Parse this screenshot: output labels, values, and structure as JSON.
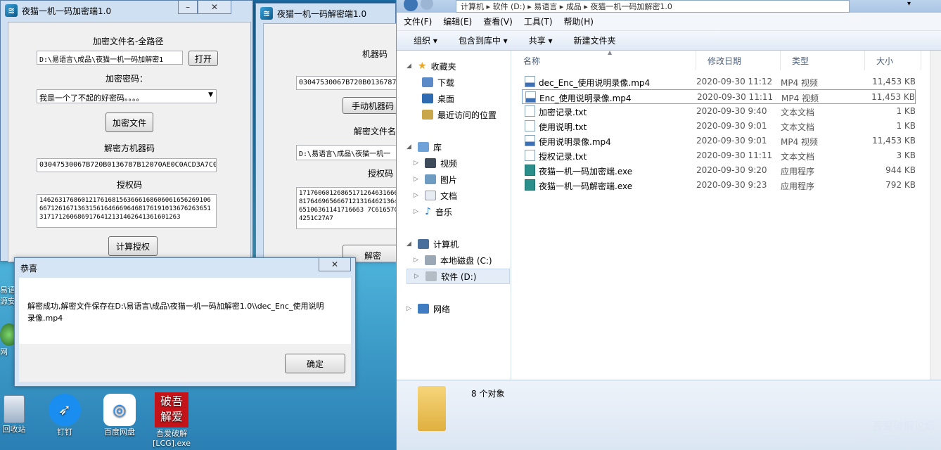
{
  "enc_window": {
    "title": "夜猫一机一码加密端1.0",
    "lbl_path": "加密文件名-全路径",
    "path_value": "D:\\易语言\\成品\\夜猫一机一码加解密1",
    "btn_open": "打开",
    "lbl_pwd": "加密密码：",
    "pwd_value": "我是一个了不起的好密码。。。。",
    "btn_encrypt": "加密文件",
    "lbl_decmachine": "解密方机器码",
    "decmachine_value": "03047530067B720B0136787B12070AE0C0ACD3A7C0",
    "lbl_auth": "授权码",
    "auth_value": "1462631768601217616815636661686060616562691066671261671363156164666964681761910136762636513171712606869176412131462641361601263",
    "btn_calc": "计算授权"
  },
  "dec_window": {
    "title": "夜猫一机一码解密端1.0",
    "lbl_machine": "机器码",
    "machine_value": "03047530067B720B01367871",
    "btn_manual": "手动机器码",
    "lbl_file": "解密文件名",
    "file_value": "D:\\易语言\\成品\\夜猫一机一",
    "lbl_auth": "授权码",
    "auth_value": "1717606012686517126463166646817646965666712131646213641365106361141716663 7C61657C694251C27A7",
    "btn_decrypt": "解密"
  },
  "dialog": {
    "title": "恭喜",
    "message": "解密成功,解密文件保存在D:\\易语言\\成品\\夜猫一机一码加解密1.0\\\\dec_Enc_使用说明录像.mp4",
    "ok": "确定"
  },
  "explorer": {
    "breadcrumb": [
      "计算机",
      "软件 (D:)",
      "易语言",
      "成品",
      "夜猫一机一码加解密1.0"
    ],
    "menu": [
      "文件(F)",
      "编辑(E)",
      "查看(V)",
      "工具(T)",
      "帮助(H)"
    ],
    "toolbar": [
      "组织 ▾",
      "包含到库中 ▾",
      "共享 ▾",
      "新建文件夹"
    ],
    "nav": {
      "favorites": "收藏夹",
      "downloads": "下载",
      "desktop": "桌面",
      "recent": "最近访问的位置",
      "libraries": "库",
      "videos": "视频",
      "pictures": "图片",
      "documents": "文档",
      "music": "音乐",
      "computer": "计算机",
      "drive_c": "本地磁盘 (C:)",
      "drive_d": "软件 (D:)",
      "network": "网络"
    },
    "columns": {
      "name": "名称",
      "date": "修改日期",
      "type": "类型",
      "size": "大小"
    },
    "files": [
      {
        "name": "dec_Enc_使用说明录像.mp4",
        "date": "2020-09-30 11:12",
        "type": "MP4 视频",
        "size": "11,453 KB",
        "icon": "video-file-icon"
      },
      {
        "name": "Enc_使用说明录像.mp4",
        "date": "2020-09-30 11:11",
        "type": "MP4 视频",
        "size": "11,453 KB",
        "icon": "video-file-icon"
      },
      {
        "name": "加密记录.txt",
        "date": "2020-09-30 9:40",
        "type": "文本文档",
        "size": "1 KB",
        "icon": "text-file-icon"
      },
      {
        "name": "使用说明.txt",
        "date": "2020-09-30 9:01",
        "type": "文本文档",
        "size": "1 KB",
        "icon": "text-file-icon"
      },
      {
        "name": "使用说明录像.mp4",
        "date": "2020-09-30 9:01",
        "type": "MP4 视频",
        "size": "11,453 KB",
        "icon": "video-file-icon"
      },
      {
        "name": "授权记录.txt",
        "date": "2020-09-30 11:11",
        "type": "文本文档",
        "size": "3 KB",
        "icon": "text-file-icon"
      },
      {
        "name": "夜猫一机一码加密端.exe",
        "date": "2020-09-30 9:20",
        "type": "应用程序",
        "size": "944 KB",
        "icon": "exe-icon"
      },
      {
        "name": "夜猫一机一码解密端.exe",
        "date": "2020-09-30 9:23",
        "type": "应用程序",
        "size": "792 KB",
        "icon": "exe-icon"
      }
    ],
    "count": "8 个对象"
  },
  "desktop": {
    "recycle": "回收站",
    "dingding": "钉钉",
    "baidu": "百度网盘",
    "pojie": "吾爱破解",
    "pojie_file": "[LCG].exe",
    "left1": "易语",
    "left2": "源安",
    "left3": "网"
  },
  "watermark": {
    "line1": "吾爱破解论坛",
    "line2": "www.52pojie.cn"
  }
}
